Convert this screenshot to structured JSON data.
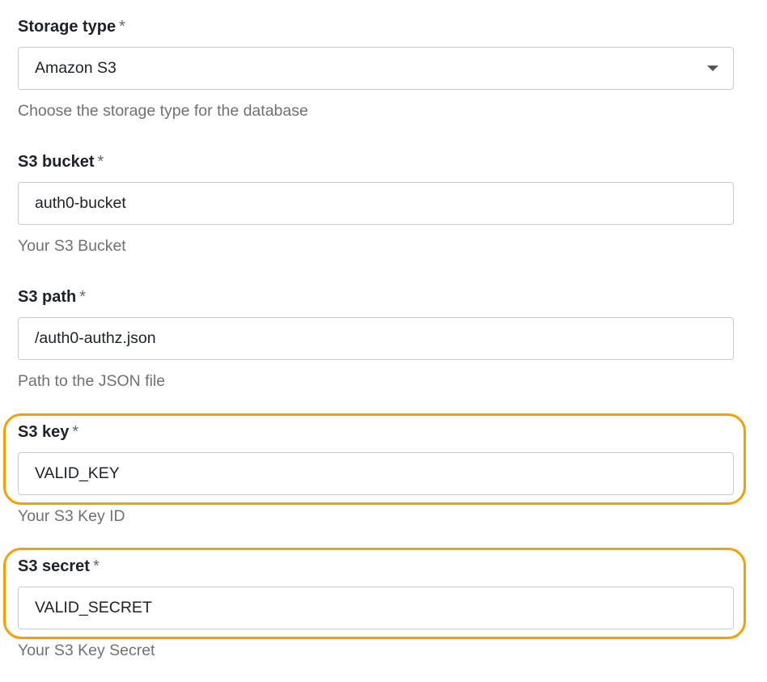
{
  "fields": [
    {
      "label": "Storage type",
      "required_mark": "*",
      "value": "Amazon S3",
      "help": "Choose the storage type for the database"
    },
    {
      "label": "S3 bucket",
      "required_mark": "*",
      "value": "auth0-bucket",
      "help": "Your S3 Bucket"
    },
    {
      "label": "S3 path",
      "required_mark": "*",
      "value": "/auth0-authz.json",
      "help": "Path to the JSON file"
    },
    {
      "label": "S3 key",
      "required_mark": "*",
      "value": "VALID_KEY",
      "help": "Your S3 Key ID"
    },
    {
      "label": "S3 secret",
      "required_mark": "*",
      "value": "VALID_SECRET",
      "help": "Your S3 Key Secret"
    }
  ],
  "colors": {
    "highlight": "#f5a000",
    "border": "#c9cace",
    "help_text": "#6f7177"
  },
  "icons": {
    "dropdown": "chevron-down-icon"
  }
}
